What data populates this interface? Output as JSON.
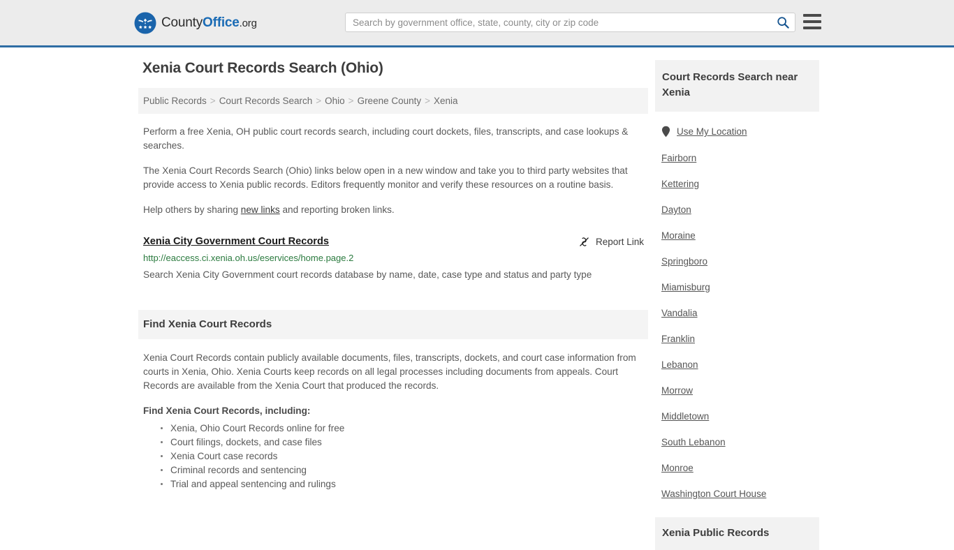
{
  "header": {
    "logo": {
      "emblem_icon": "eagle-seal-icon",
      "text_county": "County",
      "text_office": "Office",
      "text_org": ".org"
    },
    "search": {
      "placeholder": "Search by government office, state, county, city or zip code",
      "value": "",
      "icon": "search-icon"
    },
    "menu_icon": "hamburger-menu-icon",
    "accent_color": "#2e6da4",
    "background_color": "#ececec"
  },
  "main": {
    "title": "Xenia Court Records Search (Ohio)",
    "breadcrumb": [
      "Public Records",
      "Court Records Search",
      "Ohio",
      "Greene County",
      "Xenia"
    ],
    "breadcrumb_separator": ">",
    "intro_paragraphs": [
      "Perform a free Xenia, OH public court records search, including court dockets, files, transcripts, and case lookups & searches.",
      "The Xenia Court Records Search (Ohio) links below open in a new window and take you to third party websites that provide access to Xenia public records. Editors frequently monitor and verify these resources on a routine basis."
    ],
    "share_line": {
      "before": "Help others by sharing ",
      "link": "new links",
      "after": " and reporting broken links."
    },
    "result": {
      "title": "Xenia City Government Court Records",
      "url": "http://eaccess.ci.xenia.oh.us/eservices/home.page.2",
      "description": "Search Xenia City Government court records database by name, date, case type and status and party type",
      "report_label": "Report Link",
      "report_icon": "broken-link-icon",
      "url_color": "#2a7a3e"
    },
    "section": {
      "heading": "Find Xenia Court Records",
      "paragraph": "Xenia Court Records contain publicly available documents, files, transcripts, dockets, and court case information from courts in Xenia, Ohio. Xenia Courts keep records on all legal processes including documents from appeals. Court Records are available from the Xenia Court that produced the records.",
      "subheading": "Find Xenia Court Records, including:",
      "bullets": [
        "Xenia, Ohio Court Records online for free",
        "Court filings, dockets, and case files",
        "Xenia Court case records",
        "Criminal records and sentencing",
        "Trial and appeal sentencing and rulings"
      ]
    }
  },
  "sidebar": {
    "heading": "Court Records Search near Xenia",
    "use_location": {
      "label": "Use My Location",
      "icon": "map-pin-icon"
    },
    "nearby_links": [
      "Fairborn",
      "Kettering",
      "Dayton",
      "Moraine",
      "Springboro",
      "Miamisburg",
      "Vandalia",
      "Franklin",
      "Lebanon",
      "Morrow",
      "Middletown",
      "South Lebanon",
      "Monroe",
      "Washington Court House"
    ],
    "second_heading": "Xenia Public Records"
  }
}
